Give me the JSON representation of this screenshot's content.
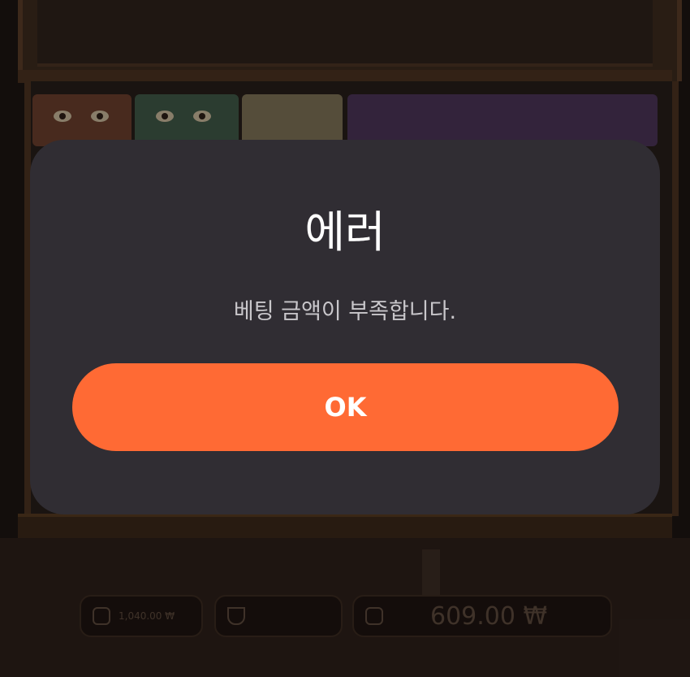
{
  "dialog": {
    "title": "에러",
    "message": "베팅 금액이 부족합니다.",
    "ok_label": "OK"
  },
  "hud": {
    "bet_amount": "1,040.00 ₩",
    "balance": "609.00 ₩",
    "icons": [
      "coins-icon",
      "trophy-icon",
      "wallet-icon"
    ]
  },
  "colors": {
    "dialog_background": "#302d33",
    "ok_button": "#ff6a34",
    "title_text": "#ffffff",
    "message_text": "#c9c7cb"
  }
}
